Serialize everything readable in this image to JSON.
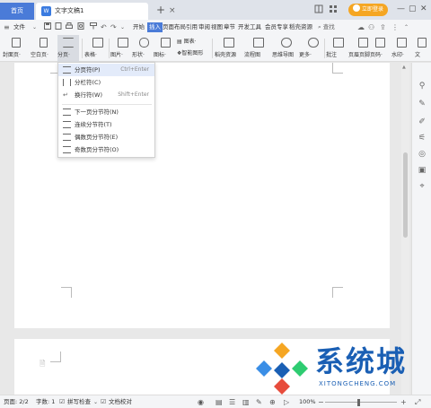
{
  "titlebar": {
    "home_tab": "首页",
    "doc_icon": "W",
    "doc_title": "文字文稿1",
    "close_glyph": "×",
    "add_glyph": "+",
    "login_label": "立即登录",
    "win_minimize": "—",
    "win_maximize": "▢",
    "win_close": "✕"
  },
  "menubar": {
    "file_label": "文件",
    "items": [
      "开始",
      "插入",
      "页面布局",
      "引用",
      "审阅",
      "视图",
      "章节",
      "开发工具",
      "会员专享",
      "稻壳资源"
    ],
    "active_item": "插入",
    "search_label": "查找"
  },
  "ribbon": {
    "buttons": [
      {
        "label": "封面页·"
      },
      {
        "label": "空白页·"
      },
      {
        "label": "分页·"
      },
      {
        "label": "表格·"
      },
      {
        "label": "图片·"
      },
      {
        "label": "形状·"
      },
      {
        "label": "图标·"
      },
      {
        "label": "图表·"
      },
      {
        "label": "智能图形"
      },
      {
        "label": "稻壳资源"
      },
      {
        "label": "流程图"
      },
      {
        "label": "思维导图"
      },
      {
        "label": "更多·"
      },
      {
        "label": "批注"
      },
      {
        "label": "页眉页脚"
      },
      {
        "label": "页码·"
      },
      {
        "label": "水印·"
      },
      {
        "label": "文"
      }
    ]
  },
  "dropdown": {
    "items": [
      {
        "label": "分页符(P)",
        "shortcut": "Ctrl+Enter",
        "highlighted": true
      },
      {
        "label": "分栏符(C)",
        "shortcut": ""
      },
      {
        "label": "换行符(W)",
        "shortcut": "Shift+Enter"
      },
      {
        "label": "下一页分节符(N)",
        "shortcut": ""
      },
      {
        "label": "连续分节符(T)",
        "shortcut": ""
      },
      {
        "label": "偶数页分节符(E)",
        "shortcut": ""
      },
      {
        "label": "奇数页分节符(O)",
        "shortcut": ""
      }
    ]
  },
  "statusbar": {
    "page": "页面: 2/2",
    "words": "字数: 1",
    "spell": "拼写检查",
    "proof": "文档校对",
    "zoom": "100%",
    "zoom_level": 1.0
  },
  "watermark": {
    "text": "系统城",
    "sub": "XITONGCHENG.COM"
  },
  "colors": {
    "accent": "#4a7bd8",
    "login": "#f5a623",
    "watermark": "#1a5fb4"
  }
}
